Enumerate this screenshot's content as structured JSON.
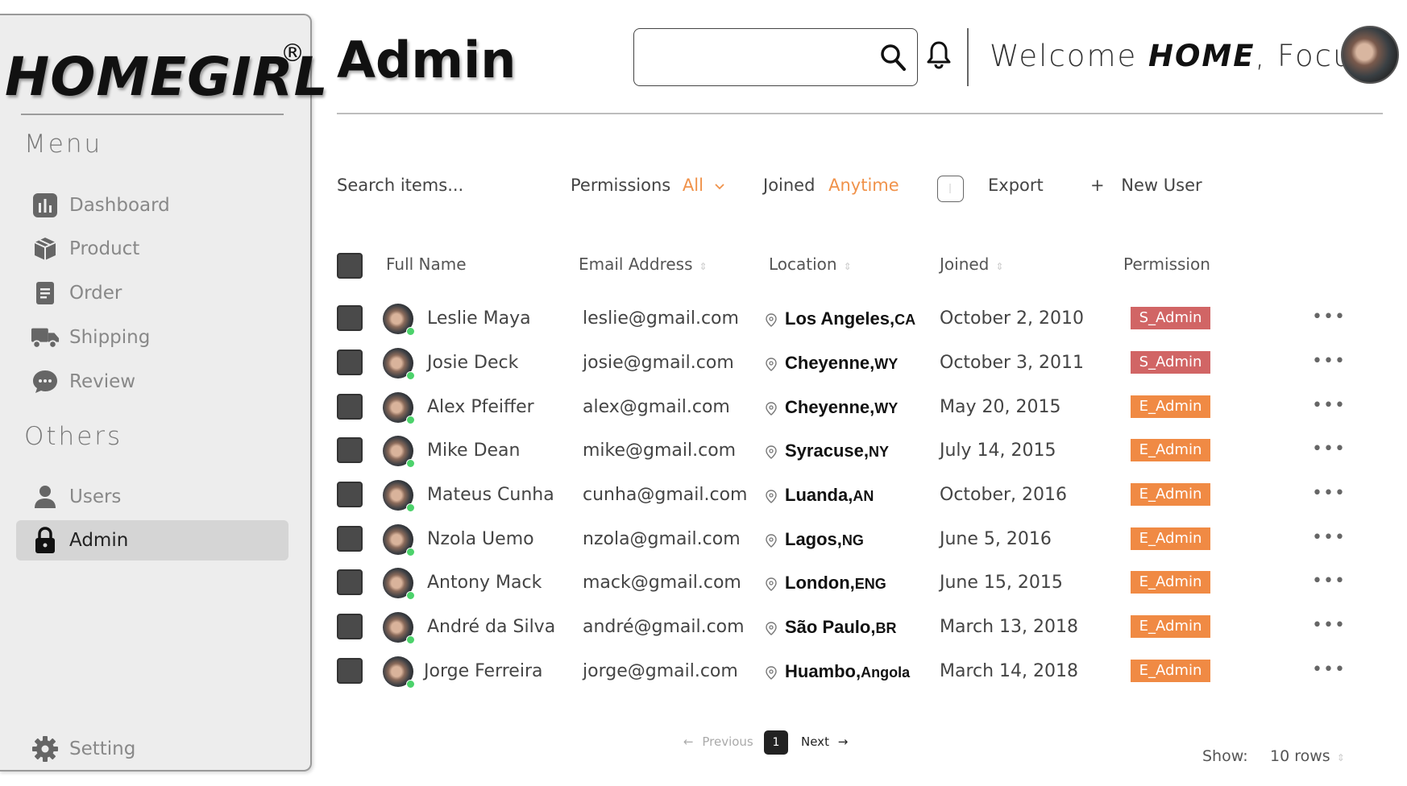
{
  "brand": {
    "name": "HOMEGIRL",
    "reg": "®"
  },
  "sidebar": {
    "menu_heading": "Menu",
    "others_heading": "Others",
    "items": [
      {
        "label": "Dashboard",
        "icon": "bar-chart-icon"
      },
      {
        "label": "Product",
        "icon": "box-icon"
      },
      {
        "label": "Order",
        "icon": "document-icon"
      },
      {
        "label": "Shipping",
        "icon": "truck-icon"
      },
      {
        "label": "Review",
        "icon": "chat-bubble-icon"
      }
    ],
    "others": [
      {
        "label": "Users",
        "icon": "user-icon"
      },
      {
        "label": "Admin",
        "icon": "lock-icon",
        "active": true
      }
    ],
    "setting_label": "Setting"
  },
  "header": {
    "title": "Admin",
    "search_value": "",
    "welcome_prefix": "Welcome ",
    "welcome_bold": "HOME",
    "welcome_suffix": ", Focus"
  },
  "toolbar": {
    "search_placeholder": "Search items...",
    "permissions_label": "Permissions",
    "permissions_value": "All",
    "joined_label": "Joined",
    "joined_value": "Anytime",
    "export_label": "Export",
    "new_user_plus": "+",
    "new_user_label": "New User"
  },
  "table": {
    "headers": {
      "name": "Full Name",
      "email": "Email Address",
      "location": "Location",
      "joined": "Joined",
      "permission": "Permission"
    },
    "rows": [
      {
        "name": "Leslie Maya",
        "email": "leslie@gmail.com",
        "city": "Los Angeles,",
        "region": "CA",
        "joined": "October 2, 2010",
        "permission": "S_Admin",
        "color": "#d16565"
      },
      {
        "name": "Josie Deck",
        "email": "josie@gmail.com",
        "city": "Cheyenne,",
        "region": "WY",
        "joined": "October 3, 2011",
        "permission": "S_Admin",
        "color": "#d16565"
      },
      {
        "name": "Alex Pfeiffer",
        "email": "alex@gmail.com",
        "city": "Cheyenne,",
        "region": "WY",
        "joined": "May 20, 2015",
        "permission": "E_Admin",
        "color": "#f08a44"
      },
      {
        "name": "Mike Dean",
        "email": "mike@gmail.com",
        "city": "Syracuse,",
        "region": "NY",
        "joined": "July 14, 2015",
        "permission": "E_Admin",
        "color": "#f08a44"
      },
      {
        "name": "Mateus Cunha",
        "email": "cunha@gmail.com",
        "city": "Luanda,",
        "region": "AN",
        "joined": "October, 2016",
        "permission": "E_Admin",
        "color": "#f08a44"
      },
      {
        "name": "Nzola Uemo",
        "email": "nzola@gmail.com",
        "city": "Lagos,",
        "region": "NG",
        "joined": "June 5, 2016",
        "permission": "E_Admin",
        "color": "#f08a44"
      },
      {
        "name": "Antony Mack",
        "email": "mack@gmail.com",
        "city": "London,",
        "region": "ENG",
        "joined": "June 15, 2015",
        "permission": "E_Admin",
        "color": "#f08a44"
      },
      {
        "name": "André da Silva",
        "email": "andré@gmail.com",
        "city": "São Paulo,",
        "region": "BR",
        "joined": "March 13, 2018",
        "permission": "E_Admin",
        "color": "#f08a44"
      },
      {
        "name": "Jorge Ferreira",
        "email": "jorge@gmail.com",
        "city": "Huambo,",
        "region": "Angola",
        "joined": "March 14, 2018",
        "permission": "E_Admin",
        "color": "#f08a44"
      }
    ]
  },
  "pagination": {
    "prev_label": "Previous",
    "current_page": "1",
    "next_label": "Next",
    "show_label": "Show:",
    "rows_value": "10 rows"
  }
}
